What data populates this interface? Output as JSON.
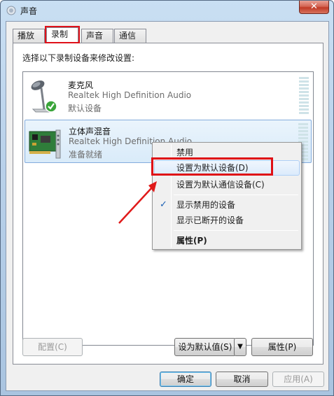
{
  "window": {
    "title": "声音",
    "close_glyph": "✕"
  },
  "tabs": [
    {
      "label": "播放"
    },
    {
      "label": "录制"
    },
    {
      "label": "声音"
    },
    {
      "label": "通信"
    }
  ],
  "instruction": "选择以下录制设备来修改设置:",
  "devices": [
    {
      "name": "麦克风",
      "description": "Realtek High Definition Audio",
      "status": "默认设备",
      "icon": "microphone-icon"
    },
    {
      "name": "立体声混音",
      "description": "Realtek High Definition Audio",
      "status": "准备就绪",
      "icon": "sound-card-icon"
    }
  ],
  "context_menu": {
    "items": [
      {
        "label": "禁用"
      },
      {
        "label": "设置为默认设备(D)"
      },
      {
        "label": "设置为默认通信设备(C)"
      },
      {
        "label": "显示禁用的设备",
        "checked": true
      },
      {
        "label": "显示已断开的设备"
      },
      {
        "label": "属性(P)"
      }
    ]
  },
  "panel_buttons": {
    "configure": "配置(C)",
    "set_default": "设为默认值(S)",
    "properties": "属性(P)"
  },
  "dialog_buttons": {
    "ok": "确定",
    "cancel": "取消",
    "apply": "应用(A)"
  },
  "colors": {
    "highlight": "#df1016",
    "selection": "#d9ebf9",
    "check": "#1a5fb4"
  }
}
